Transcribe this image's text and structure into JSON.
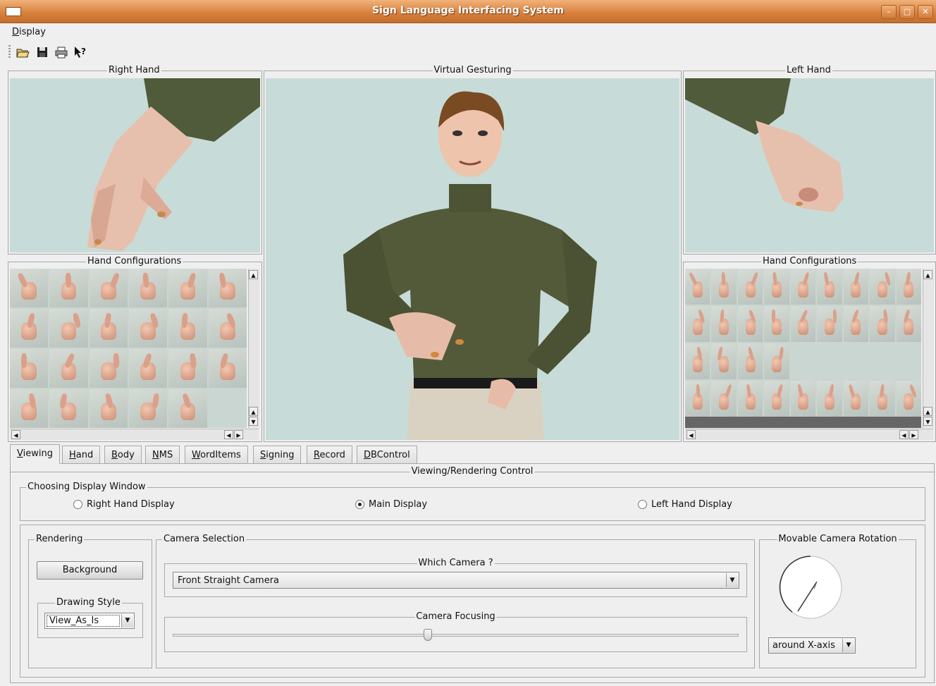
{
  "window": {
    "title": "Sign Language Interfacing System"
  },
  "menu": {
    "display_label": "Display"
  },
  "toolbar": {
    "icons": [
      "open-folder-icon",
      "save-icon",
      "print-icon",
      "whats-this-help-icon"
    ]
  },
  "panels": {
    "right_hand": "Right Hand",
    "virtual_gesturing": "Virtual Gesturing",
    "left_hand": "Left Hand",
    "hand_config_left": "Hand Configurations",
    "hand_config_right": "Hand Configurations"
  },
  "tabs": [
    {
      "label": "Viewing",
      "mnemonic": "V"
    },
    {
      "label": "Hand",
      "mnemonic": "H"
    },
    {
      "label": "Body",
      "mnemonic": "B"
    },
    {
      "label": "NMS",
      "mnemonic": "N"
    },
    {
      "label": "WordItems",
      "mnemonic": "W"
    },
    {
      "label": "Signing",
      "mnemonic": "S"
    },
    {
      "label": "Record",
      "mnemonic": "R"
    },
    {
      "label": "DBControl",
      "mnemonic": "D"
    }
  ],
  "viewing": {
    "title": "Viewing/Rendering Control",
    "display_window": {
      "label": "Choosing Display Window",
      "options": [
        "Right Hand Display",
        "Main Display",
        "Left Hand Display"
      ],
      "selected": "Main Display"
    },
    "rendering": {
      "label": "Rendering",
      "background_button": "Background",
      "drawing_style_label": "Drawing Style",
      "drawing_style_value": "View_As_Is"
    },
    "camera": {
      "label": "Camera Selection",
      "which_label": "Which Camera ?",
      "which_value": "Front Straight Camera",
      "focusing_label": "Camera Focusing",
      "focusing_value": 0.45
    },
    "rotation": {
      "label": "Movable Camera Rotation",
      "axis_value": "around X-axis"
    }
  }
}
